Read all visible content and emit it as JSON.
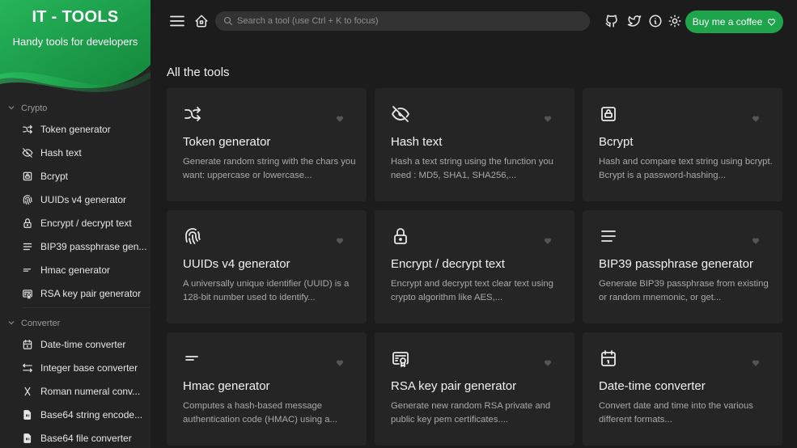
{
  "brand": {
    "title": "IT - TOOLS",
    "subtitle": "Handy tools for developers",
    "accent": "#1ea54c"
  },
  "sidebar": {
    "groups": [
      {
        "label": "Crypto",
        "items": [
          {
            "label": "Token generator",
            "icon": "shuffle-icon"
          },
          {
            "label": "Hash text",
            "icon": "eye-off-icon"
          },
          {
            "label": "Bcrypt",
            "icon": "lock-square-icon"
          },
          {
            "label": "UUIDs v4 generator",
            "icon": "fingerprint-icon"
          },
          {
            "label": "Encrypt / decrypt text",
            "icon": "lock-icon"
          },
          {
            "label": "BIP39 passphrase gen...",
            "icon": "align-justified-icon"
          },
          {
            "label": "Hmac generator",
            "icon": "short-text-icon"
          },
          {
            "label": "RSA key pair generator",
            "icon": "certificate-icon"
          }
        ]
      },
      {
        "label": "Converter",
        "items": [
          {
            "label": "Date-time converter",
            "icon": "calendar-icon"
          },
          {
            "label": "Integer base converter",
            "icon": "arrows-left-right-icon"
          },
          {
            "label": "Roman numeral conv...",
            "icon": "letter-x-icon"
          },
          {
            "label": "Base64 string encode...",
            "icon": "file-digit-icon"
          },
          {
            "label": "Base64 file converter",
            "icon": "file-digit-icon"
          }
        ]
      }
    ]
  },
  "topbar": {
    "search_placeholder": "Search a tool (use Ctrl + K to focus)",
    "coffee_label": "Buy me a coffee"
  },
  "main": {
    "section_title": "All the tools",
    "cards": [
      {
        "title": "Token generator",
        "desc": "Generate random string with the chars you want: uppercase or lowercase...",
        "icon": "shuffle-icon"
      },
      {
        "title": "Hash text",
        "desc": "Hash a text string using the function you need : MD5, SHA1, SHA256,...",
        "icon": "eye-off-icon"
      },
      {
        "title": "Bcrypt",
        "desc": "Hash and compare text string using bcrypt. Bcrypt is a password-hashing...",
        "icon": "lock-square-icon"
      },
      {
        "title": "UUIDs v4 generator",
        "desc": "A universally unique identifier (UUID) is a 128-bit number used to identify...",
        "icon": "fingerprint-icon"
      },
      {
        "title": "Encrypt / decrypt text",
        "desc": "Encrypt and decrypt text clear text using crypto algorithm like AES,...",
        "icon": "lock-icon"
      },
      {
        "title": "BIP39 passphrase generator",
        "desc": "Generate BIP39 passphrase from existing or random mnemonic, or get...",
        "icon": "align-justified-icon"
      },
      {
        "title": "Hmac generator",
        "desc": "Computes a hash-based message authentication code (HMAC) using a...",
        "icon": "short-text-icon"
      },
      {
        "title": "RSA key pair generator",
        "desc": "Generate new random RSA private and public key pem certificates....",
        "icon": "certificate-icon"
      },
      {
        "title": "Date-time converter",
        "desc": "Convert date and time into the various different formats...",
        "icon": "calendar-icon"
      }
    ]
  }
}
